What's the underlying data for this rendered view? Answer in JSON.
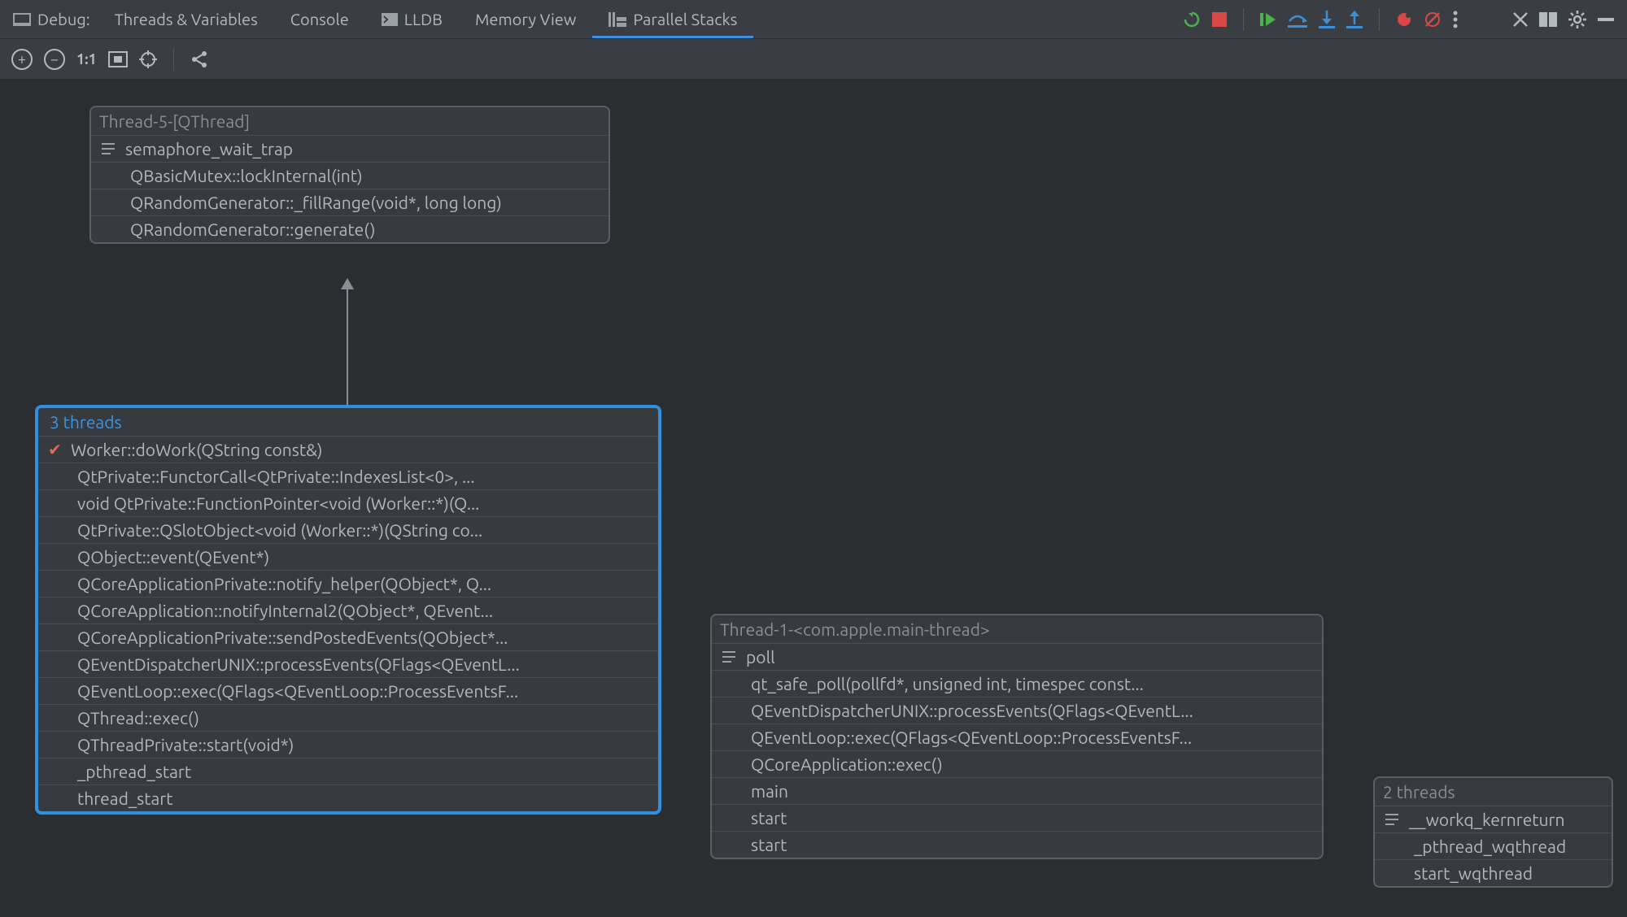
{
  "header": {
    "title": "Debug:",
    "tabs": [
      {
        "label": "Threads & Variables"
      },
      {
        "label": "Console"
      },
      {
        "label": "LLDB"
      },
      {
        "label": "Memory View"
      },
      {
        "label": "Parallel Stacks"
      }
    ]
  },
  "sub_toolbar": {
    "fit_label": "1:1"
  },
  "stacks": {
    "box_a": {
      "title": "Thread-5-[QThread]",
      "frames": [
        "semaphore_wait_trap",
        "QBasicMutex::lockInternal(int)",
        "QRandomGenerator::_fillRange(void*, long long)",
        "QRandomGenerator::generate()"
      ]
    },
    "box_b": {
      "title": "3 threads",
      "frames": [
        "Worker::doWork(QString const&)",
        "QtPrivate::FunctorCall<QtPrivate::IndexesList<0>, ...",
        "void QtPrivate::FunctionPointer<void (Worker::*)(Q...",
        "QtPrivate::QSlotObject<void (Worker::*)(QString co...",
        "QObject::event(QEvent*)",
        "QCoreApplicationPrivate::notify_helper(QObject*, Q...",
        "QCoreApplication::notifyInternal2(QObject*, QEvent...",
        "QCoreApplicationPrivate::sendPostedEvents(QObject*...",
        "QEventDispatcherUNIX::processEvents(QFlags<QEventL...",
        "QEventLoop::exec(QFlags<QEventLoop::ProcessEventsF...",
        "QThread::exec()",
        "QThreadPrivate::start(void*)",
        "_pthread_start",
        "thread_start"
      ]
    },
    "box_c": {
      "title": "Thread-1-<com.apple.main-thread>",
      "frames": [
        "poll",
        "qt_safe_poll(pollfd*, unsigned int, timespec const...",
        "QEventDispatcherUNIX::processEvents(QFlags<QEventL...",
        "QEventLoop::exec(QFlags<QEventLoop::ProcessEventsF...",
        "QCoreApplication::exec()",
        "main",
        "start",
        "start"
      ]
    },
    "box_d": {
      "title": "2 threads",
      "frames": [
        "__workq_kernreturn",
        "_pthread_wqthread",
        "start_wqthread"
      ]
    }
  }
}
